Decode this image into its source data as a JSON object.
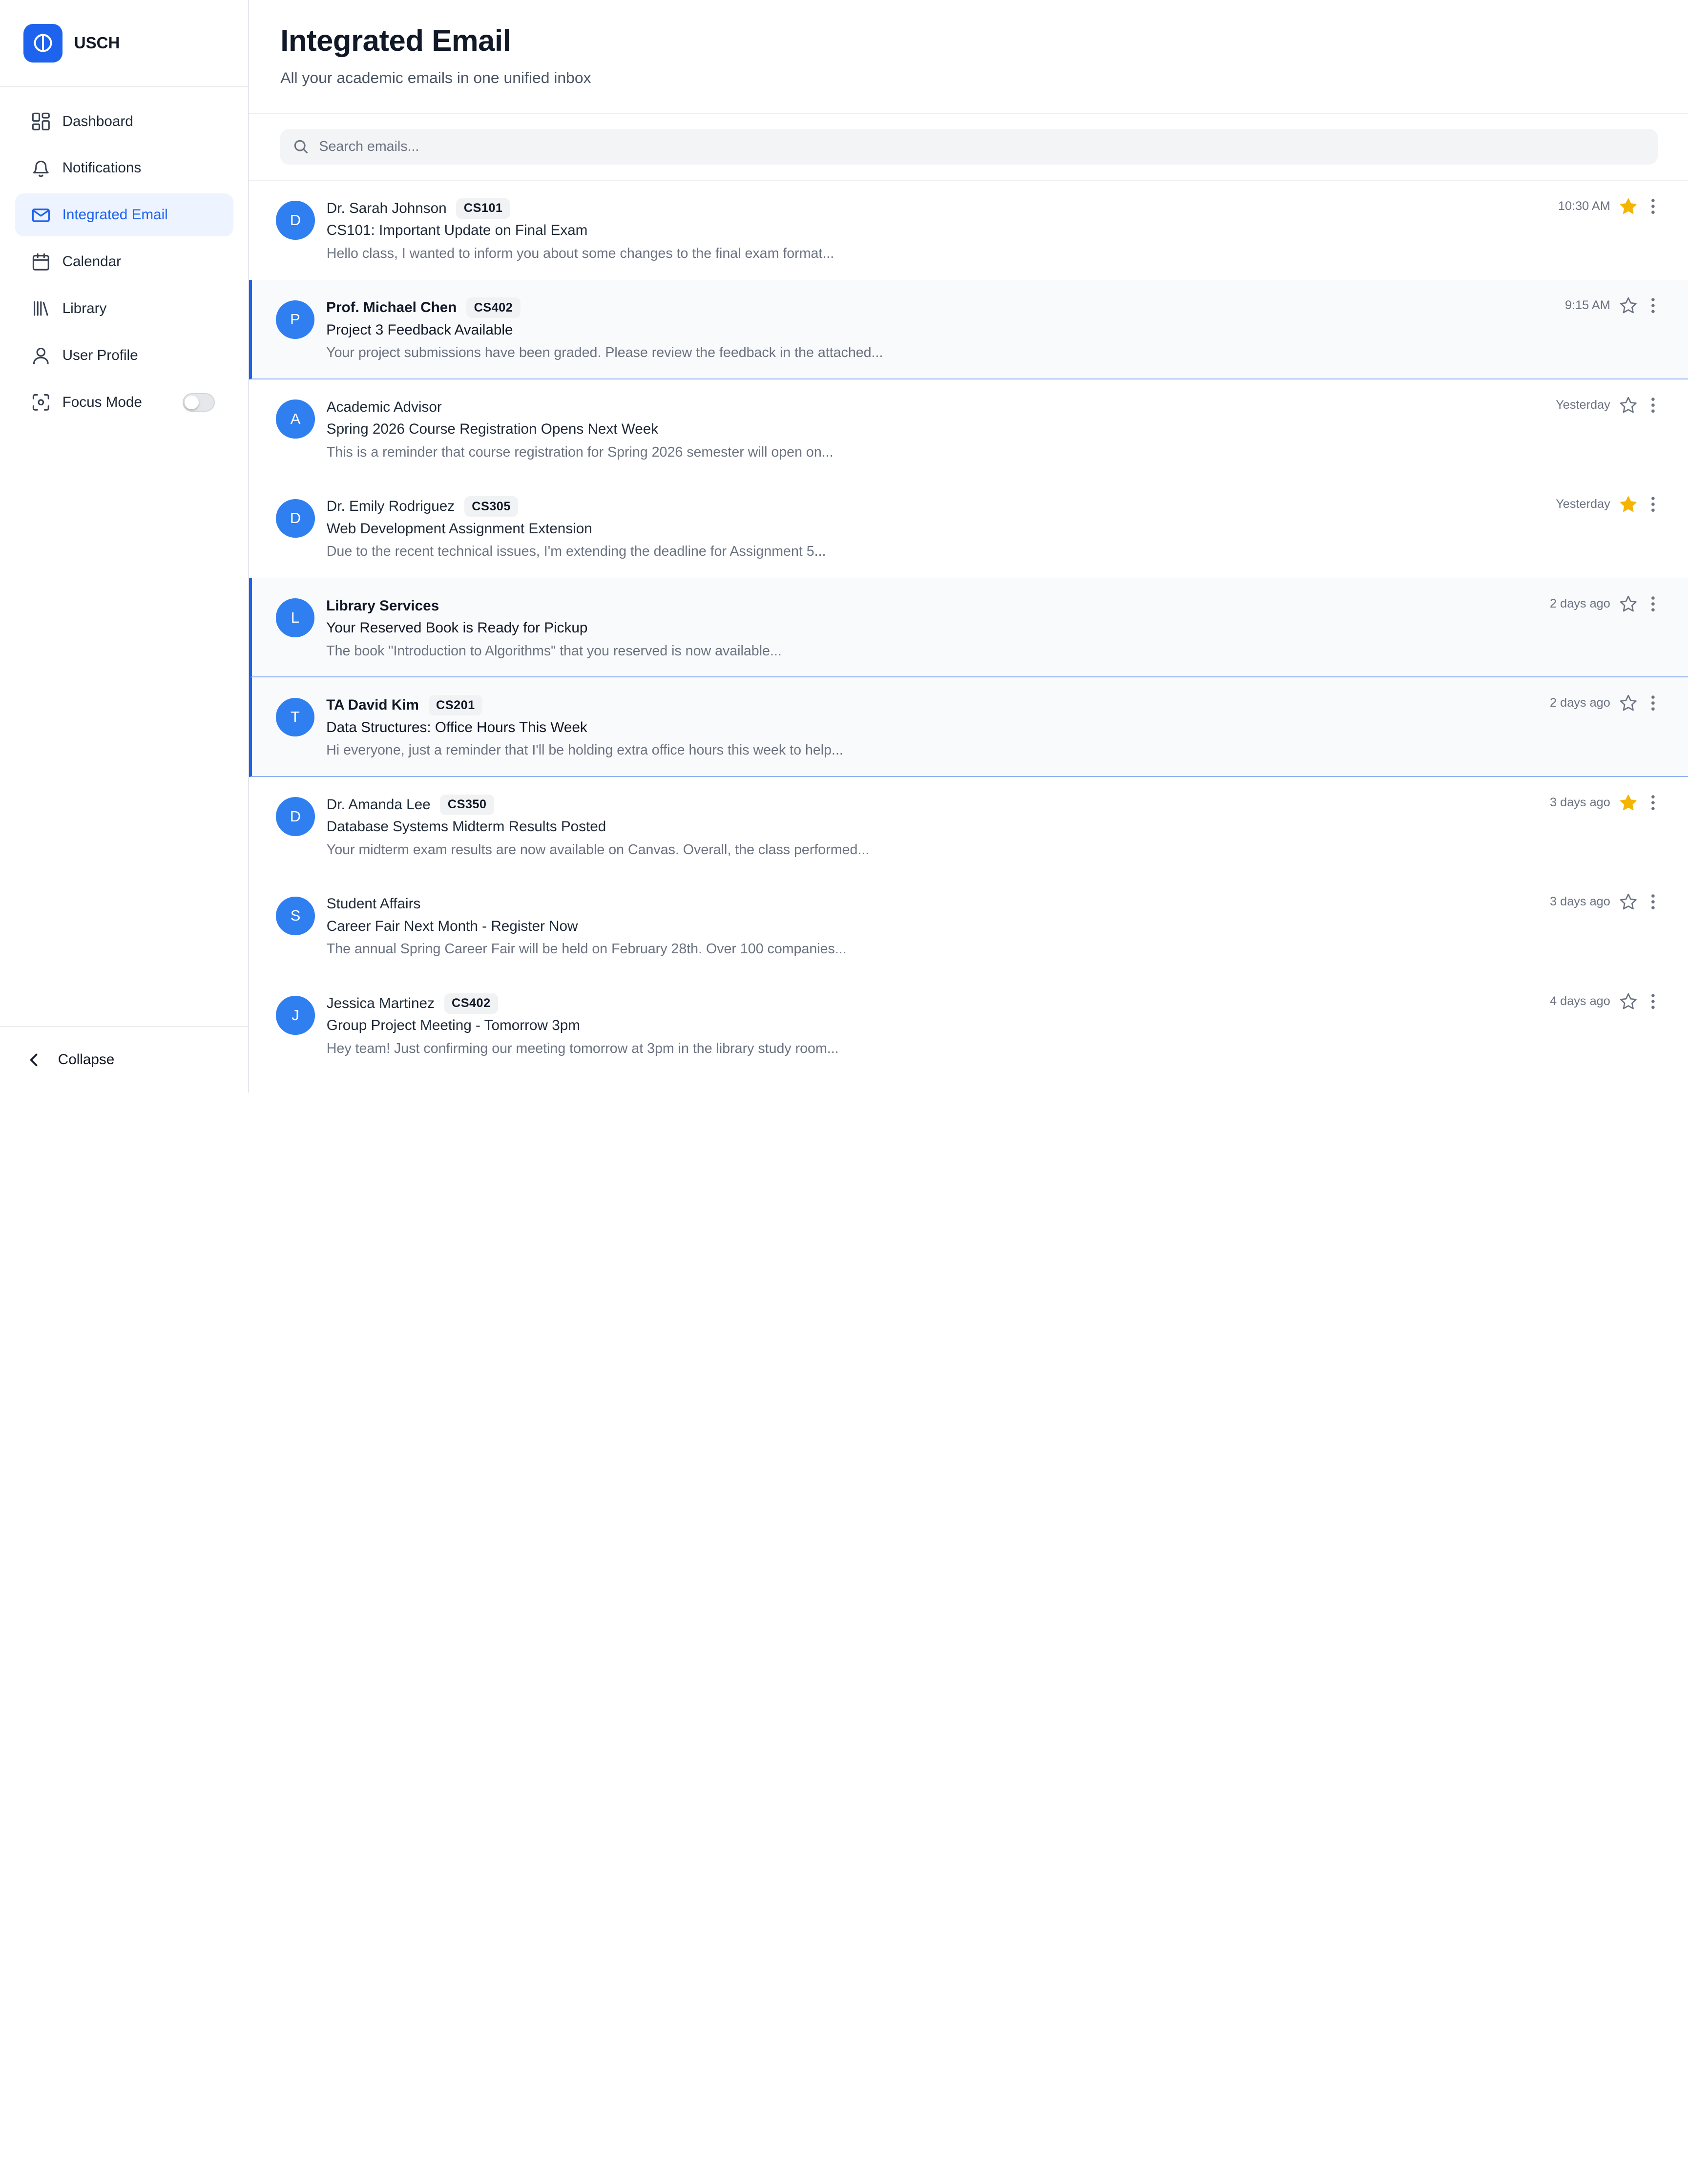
{
  "brand": {
    "name": "USCH",
    "color": "#1d63ed"
  },
  "sidebar": {
    "items": [
      {
        "label": "Dashboard",
        "icon": "dashboard-icon"
      },
      {
        "label": "Notifications",
        "icon": "bell-icon"
      },
      {
        "label": "Integrated Email",
        "icon": "mail-icon",
        "active": true
      },
      {
        "label": "Calendar",
        "icon": "calendar-icon"
      },
      {
        "label": "Library",
        "icon": "library-icon"
      },
      {
        "label": "User Profile",
        "icon": "user-icon"
      },
      {
        "label": "Focus Mode",
        "icon": "focus-icon",
        "toggle": false
      }
    ],
    "collapse_label": "Collapse"
  },
  "header": {
    "title": "Integrated Email",
    "subtitle": "All your academic emails in one unified inbox"
  },
  "search": {
    "placeholder": "Search emails..."
  },
  "emails": [
    {
      "initial": "D",
      "sender": "Dr. Sarah Johnson",
      "course": "CS101",
      "subject": "CS101: Important Update on Final Exam",
      "preview": "Hello class, I wanted to inform you about some changes to the final exam format...",
      "time": "10:30 AM",
      "starred": true,
      "unread": false
    },
    {
      "initial": "P",
      "sender": "Prof. Michael Chen",
      "course": "CS402",
      "subject": "Project 3 Feedback Available",
      "preview": "Your project submissions have been graded. Please review the feedback in the attached...",
      "time": "9:15 AM",
      "starred": false,
      "unread": true
    },
    {
      "initial": "A",
      "sender": "Academic Advisor",
      "course": "",
      "subject": "Spring 2026 Course Registration Opens Next Week",
      "preview": "This is a reminder that course registration for Spring 2026 semester will open on...",
      "time": "Yesterday",
      "starred": false,
      "unread": false
    },
    {
      "initial": "D",
      "sender": "Dr. Emily Rodriguez",
      "course": "CS305",
      "subject": "Web Development Assignment Extension",
      "preview": "Due to the recent technical issues, I'm extending the deadline for Assignment 5...",
      "time": "Yesterday",
      "starred": true,
      "unread": false
    },
    {
      "initial": "L",
      "sender": "Library Services",
      "course": "",
      "subject": "Your Reserved Book is Ready for Pickup",
      "preview": "The book \"Introduction to Algorithms\" that you reserved is now available...",
      "time": "2 days ago",
      "starred": false,
      "unread": true
    },
    {
      "initial": "T",
      "sender": "TA David Kim",
      "course": "CS201",
      "subject": "Data Structures: Office Hours This Week",
      "preview": "Hi everyone, just a reminder that I'll be holding extra office hours this week to help...",
      "time": "2 days ago",
      "starred": false,
      "unread": true
    },
    {
      "initial": "D",
      "sender": "Dr. Amanda Lee",
      "course": "CS350",
      "subject": "Database Systems Midterm Results Posted",
      "preview": "Your midterm exam results are now available on Canvas. Overall, the class performed...",
      "time": "3 days ago",
      "starred": true,
      "unread": false
    },
    {
      "initial": "S",
      "sender": "Student Affairs",
      "course": "",
      "subject": "Career Fair Next Month - Register Now",
      "preview": "The annual Spring Career Fair will be held on February 28th. Over 100 companies...",
      "time": "3 days ago",
      "starred": false,
      "unread": false
    },
    {
      "initial": "J",
      "sender": "Jessica Martinez",
      "course": "CS402",
      "subject": "Group Project Meeting - Tomorrow 3pm",
      "preview": "Hey team! Just confirming our meeting tomorrow at 3pm in the library study room...",
      "time": "4 days ago",
      "starred": false,
      "unread": false
    }
  ],
  "colors": {
    "accent": "#1d63ed",
    "avatar": "#2f7ff0",
    "star": "#f5b400"
  }
}
